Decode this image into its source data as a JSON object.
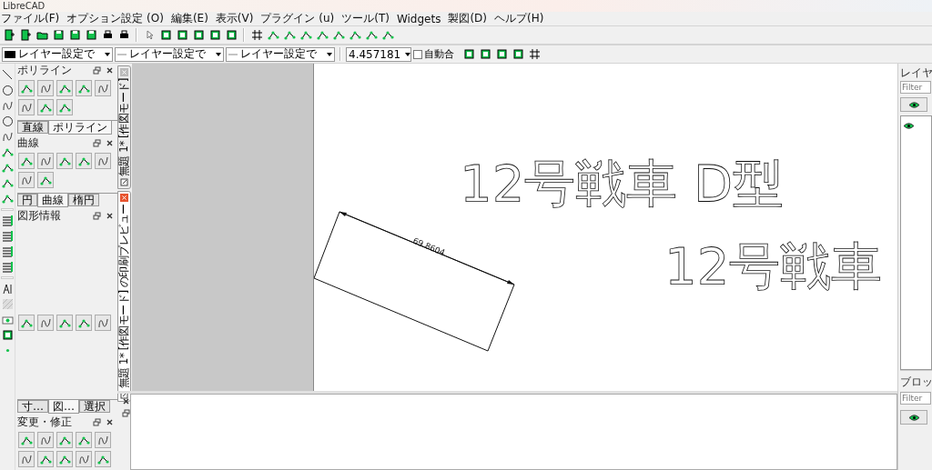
{
  "window": {
    "title": "LibreCAD"
  },
  "menu": [
    "ファイル(F)",
    "オプション設定 (O)",
    "編集(E)",
    "表示(V)",
    "プラグイン (u)",
    "ツール(T)",
    "Widgets",
    "製図(D)",
    "ヘルプ(H)"
  ],
  "pen_toolbar": {
    "pen_setting": "レイヤー設定で",
    "line_type": "レイヤー設定で",
    "line_width": "レイヤー設定で",
    "scale": "4.457181",
    "auto": {
      "label": "自動合",
      "checked": false
    }
  },
  "left_dock": {
    "sections": [
      {
        "kind": "panel",
        "title": "ポリライン"
      },
      {
        "kind": "tabs",
        "tabs": [
          {
            "label": "直線",
            "selected": false
          },
          {
            "label": "ポリライン",
            "selected": true
          }
        ]
      },
      {
        "kind": "panel",
        "title": "曲線"
      },
      {
        "kind": "tabs",
        "tabs": [
          {
            "label": "円",
            "selected": false
          },
          {
            "label": "曲線",
            "selected": true
          },
          {
            "label": "楕円",
            "selected": false
          }
        ]
      },
      {
        "kind": "panel",
        "title": "図形情報"
      },
      {
        "kind": "buttons"
      },
      {
        "kind": "tabs",
        "tabs": [
          {
            "label": "寸…",
            "selected": false
          },
          {
            "label": "図…",
            "selected": true
          },
          {
            "label": "選択",
            "selected": false
          }
        ]
      },
      {
        "kind": "panel",
        "title": "変更・修正"
      }
    ]
  },
  "document_tabs": [
    {
      "label": "無題 1* [作図モード]",
      "selected": false
    },
    {
      "label": "無題 1* [作図モード] の印刷プレビュー",
      "selected": true
    }
  ],
  "drawing": {
    "texts": [
      "12号戦車 D型",
      "12号戦車"
    ],
    "dimension": "69.8604"
  },
  "right_dock": {
    "layers": {
      "title": "レイヤ",
      "filter_placeholder": "Filter"
    },
    "blocks": {
      "title": "ブロッ",
      "filter_placeholder": "Filter"
    }
  }
}
